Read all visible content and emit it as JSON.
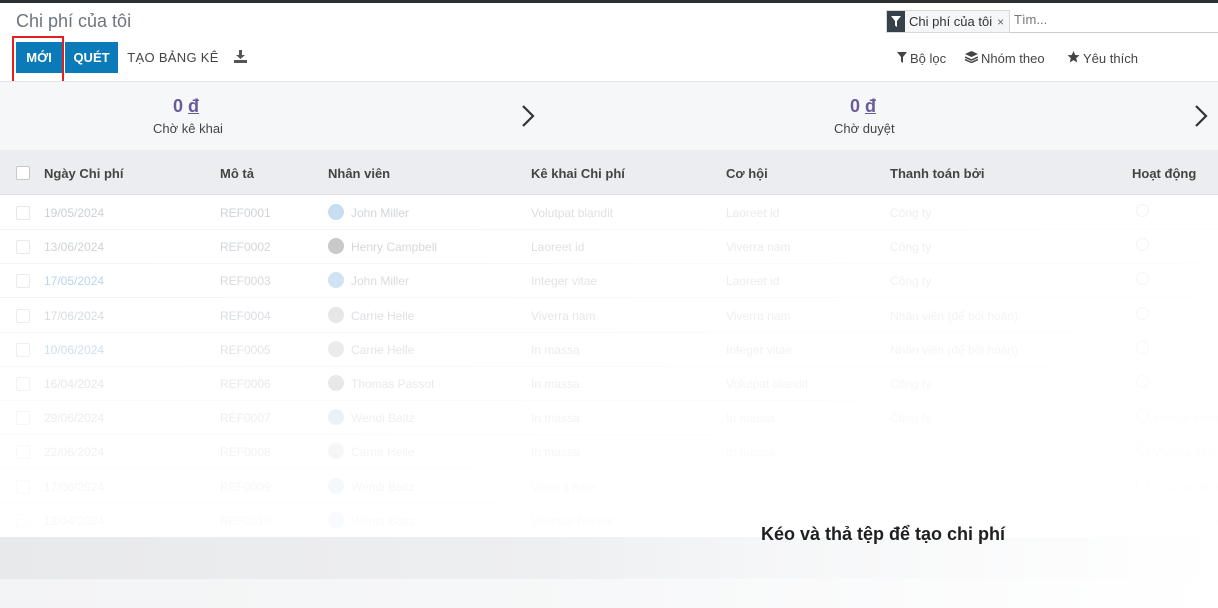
{
  "header": {
    "title": "Chi phí của tôi"
  },
  "search": {
    "facet_label": "Chi phí của tôi",
    "facet_remove": "×",
    "placeholder": "Tìm..."
  },
  "toolbar": {
    "new_label": "MỚI",
    "scan_label": "QUÉT",
    "report_label": "TẠO BẢNG KÊ",
    "download_icon": "download-icon"
  },
  "controls": {
    "filter_label": "Bộ lọc",
    "group_label": "Nhóm theo",
    "favorite_label": "Yêu thích"
  },
  "summary": [
    {
      "amount": "0",
      "currency": "đ",
      "label": "Chờ kê khai"
    },
    {
      "amount": "0",
      "currency": "đ",
      "label": "Chờ duyệt"
    }
  ],
  "table": {
    "columns": [
      "Ngày Chi phí",
      "Mô tả",
      "Nhân viên",
      "Kê khai Chi phí",
      "Cơ hội",
      "Thanh toán bởi",
      "Hoạt động"
    ],
    "rows": [
      {
        "date": "19/05/2024",
        "ref": "REF0001",
        "employee": "John Miller",
        "report": "Volutpat blandit",
        "opportunity": "Laoreet id",
        "paid_by": "Công ty",
        "activity": ""
      },
      {
        "date": "13/06/2024",
        "ref": "REF0002",
        "employee": "Henry Campbell",
        "report": "Laoreet id",
        "opportunity": "Viverra nam",
        "paid_by": "Công ty",
        "activity": ""
      },
      {
        "date": "17/05/2024",
        "ref": "REF0003",
        "employee": "John Miller",
        "report": "Integer vitae",
        "opportunity": "Laoreet id",
        "paid_by": "Công ty",
        "activity": ""
      },
      {
        "date": "17/06/2024",
        "ref": "REF0004",
        "employee": "Carrie Helle",
        "report": "Viverra nam",
        "opportunity": "Viverra nam",
        "paid_by": "Nhân viên (để bồi hoàn)",
        "activity": ""
      },
      {
        "date": "10/06/2024",
        "ref": "REF0005",
        "employee": "Carrie Helle",
        "report": "In massa",
        "opportunity": "Integer vitae",
        "paid_by": "Nhân viên (để bồi hoàn)",
        "activity": ""
      },
      {
        "date": "16/04/2024",
        "ref": "REF0006",
        "employee": "Thomas Passot",
        "report": "In massa",
        "opportunity": "Volutpat blandit",
        "paid_by": "Công ty",
        "activity": ""
      },
      {
        "date": "29/06/2024",
        "ref": "REF0007",
        "employee": "Wendi Baltz",
        "report": "In massa",
        "opportunity": "In massa",
        "paid_by": "Công ty",
        "activity": "Integer vitae"
      },
      {
        "date": "22/06/2024",
        "ref": "REF0008",
        "employee": "Carrie Helle",
        "report": "In massa",
        "opportunity": "In massa",
        "paid_by": "",
        "activity": "Viverra nam"
      },
      {
        "date": "17/06/2024",
        "ref": "REF0009",
        "employee": "Wendi Baltz",
        "report": "Viverra nam",
        "opportunity": "",
        "paid_by": "",
        "activity": "Volutpat blandit"
      },
      {
        "date": "12/04/2024",
        "ref": "REF0010",
        "employee": "Wendi Baltz",
        "report": "Volutpat blandit",
        "opportunity": "",
        "paid_by": "",
        "activity": "Volutpat blandit"
      }
    ]
  },
  "dropzone": {
    "message": "Kéo và thả tệp để tạo chi phí"
  },
  "colors": {
    "primary": "#0a7bb8",
    "highlight": "#e02020",
    "summary_value": "#6a5a9a"
  }
}
